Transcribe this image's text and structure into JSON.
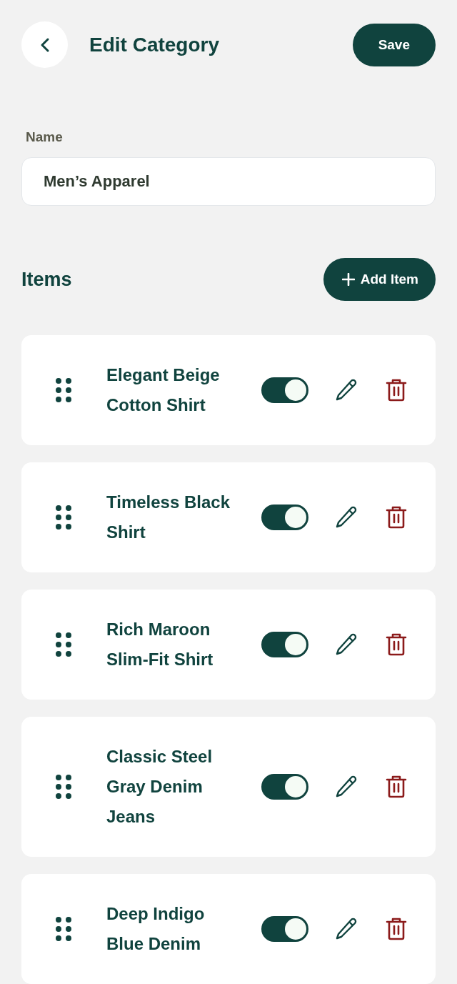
{
  "header": {
    "title": "Edit Category",
    "save_label": "Save"
  },
  "name_field": {
    "label": "Name",
    "value": "Men’s Apparel"
  },
  "items_section": {
    "title": "Items",
    "add_label": "Add Item"
  },
  "items": [
    {
      "name": "Elegant Beige Cotton Shirt",
      "on": true
    },
    {
      "name": "Timeless Black Shirt",
      "on": true
    },
    {
      "name": "Rich Maroon Slim-Fit Shirt",
      "on": true
    },
    {
      "name": "Classic Steel Gray Denim Jeans",
      "on": true
    },
    {
      "name": "Deep Indigo Blue Denim",
      "on": true
    }
  ]
}
